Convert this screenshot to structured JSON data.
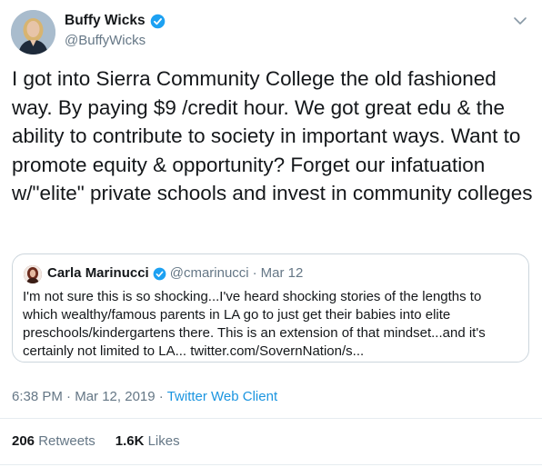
{
  "author": {
    "name": "Buffy Wicks",
    "handle": "@BuffyWicks"
  },
  "tweet_text": "I got into Sierra Community College the old fashioned way. By paying $9 /credit hour. We got great edu & the ability to contribute to society in important ways. Want to promote equity & opportunity? Forget our infatuation w/\"elite\" private schools and invest in community colleges",
  "quoted": {
    "name": "Carla Marinucci",
    "handle": "@cmarinucci",
    "separator": "·",
    "date": "Mar 12",
    "text": "I'm not sure this is so shocking...I've heard shocking stories of the lengths to which wealthy/famous parents in LA go to just get their babies into elite preschools/kindergartens there. This is an extension of that mindset...and it's certainly not limited to LA... twitter.com/SovernNation/s..."
  },
  "meta": {
    "time": "6:38 PM",
    "separator": "·",
    "date": "Mar 12, 2019",
    "client": "Twitter Web Client"
  },
  "stats": {
    "retweets_count": "206",
    "retweets_label": "Retweets",
    "likes_count": "1.6K",
    "likes_label": "Likes"
  },
  "icons": {
    "verified": "verified-badge-icon",
    "caret": "chevron-down-icon"
  },
  "colors": {
    "link": "#1b95e0",
    "verified": "#1da1f2",
    "muted": "#657786",
    "text": "#14171a",
    "border": "#ccd6dd"
  }
}
